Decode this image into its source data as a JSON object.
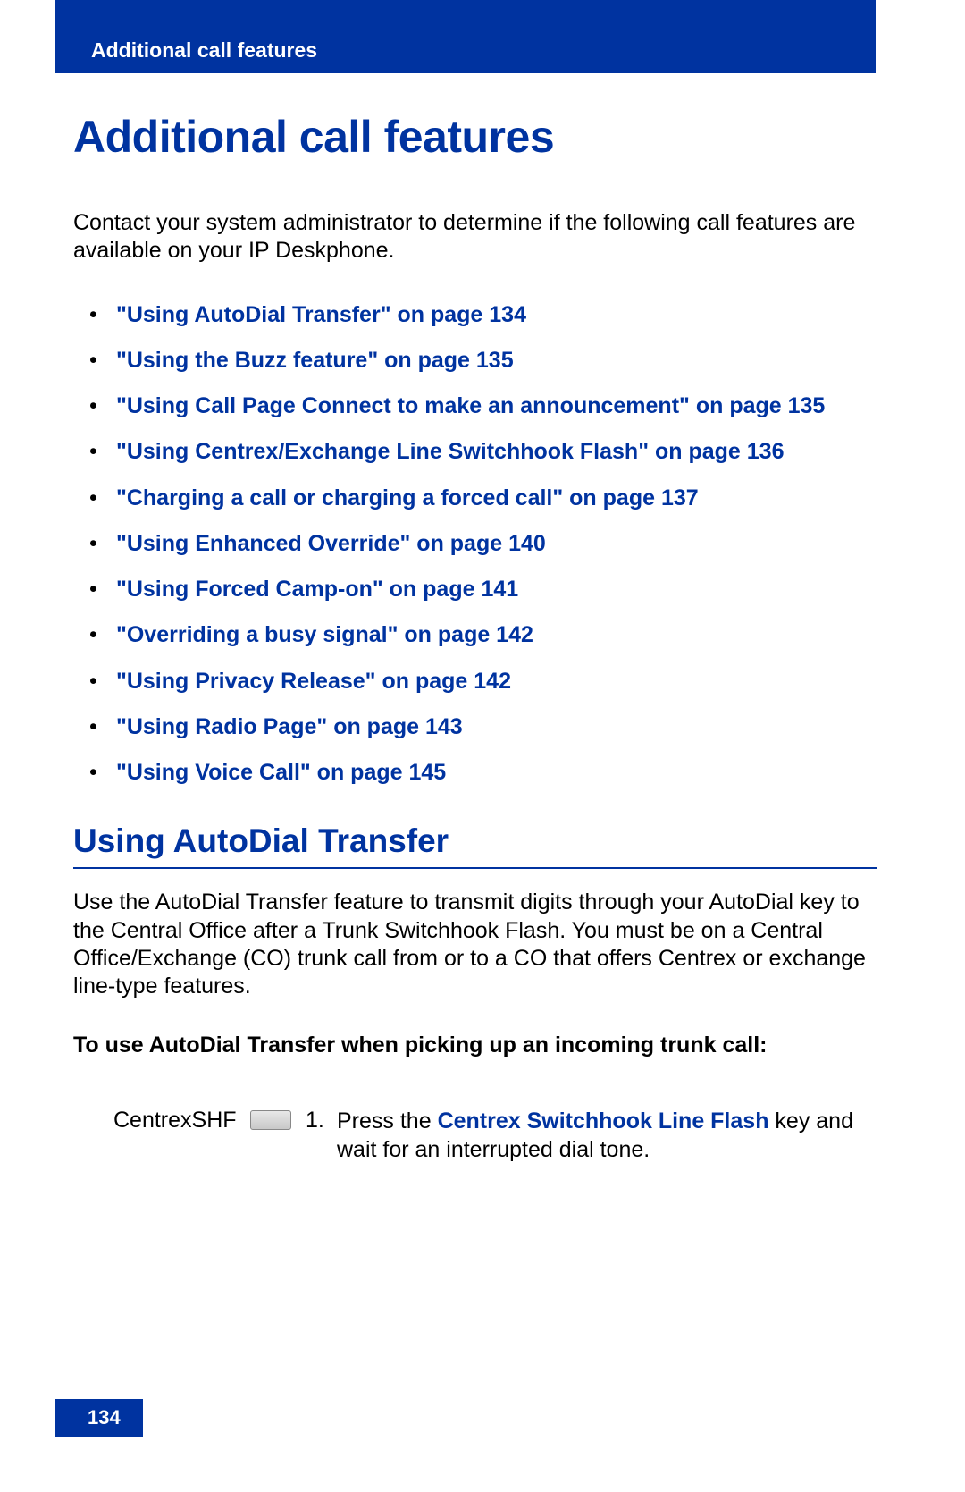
{
  "header": {
    "running_head": "Additional call features"
  },
  "title": "Additional call features",
  "intro": "Contact your system administrator to determine if the following call features are available on your IP Deskphone.",
  "toc": [
    "\"Using AutoDial Transfer\" on page 134",
    "\"Using the Buzz feature\" on page 135",
    "\"Using Call Page Connect to make an announcement\" on page 135",
    "\"Using Centrex/Exchange Line Switchhook Flash\" on page 136",
    "\"Charging a call or charging a forced call\" on page 137",
    "\"Using Enhanced Override\" on page 140",
    "\"Using Forced Camp-on\" on page 141",
    "\"Overriding a busy signal\" on page 142",
    "\"Using Privacy Release\" on page 142",
    "\"Using Radio Page\" on page 143",
    "\"Using Voice Call\" on page 145"
  ],
  "section": {
    "heading": "Using AutoDial Transfer",
    "body": "Use the AutoDial Transfer feature to transmit digits through your AutoDial key to the Central Office after a Trunk Switchhook Flash. You must be on a Central Office/Exchange (CO) trunk call from or to a CO that offers Centrex or exchange line-type features.",
    "subheading": "To use AutoDial Transfer when picking up an incoming trunk call:",
    "step": {
      "key_label": "CentrexSHF",
      "number": "1.",
      "text_prefix": "Press the ",
      "text_em": "Centrex Switchhook Line Flash",
      "text_suffix": " key and wait for an interrupted dial tone."
    }
  },
  "footer": {
    "page_number": "134"
  }
}
